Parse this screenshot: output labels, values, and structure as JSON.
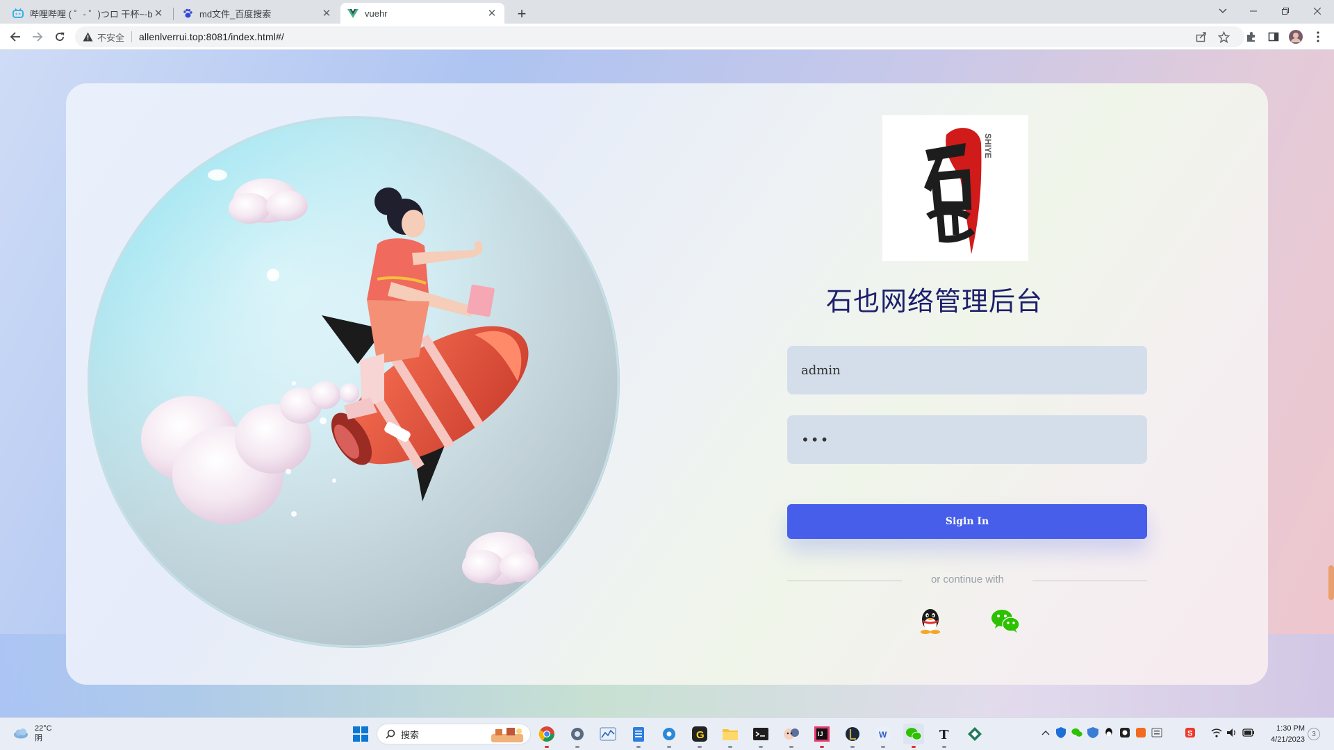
{
  "browser": {
    "tabs": [
      {
        "title": "哔哩哔哩 ( ゜- ゜)つロ 干杯~-bili",
        "icon": "bilibili-icon",
        "active": false
      },
      {
        "title": "md文件_百度搜索",
        "icon": "baidu-paw-icon",
        "active": false
      },
      {
        "title": "vuehr",
        "icon": "vue-icon",
        "active": true
      }
    ],
    "security_label": "不安全",
    "url": "allenlverrui.top:8081/index.html#/"
  },
  "login": {
    "logo_text": "SHIYE",
    "title": "石也网络管理后台",
    "username_value": "admin",
    "password_mask": "•••",
    "signin_label": "Sigin In",
    "divider_text": "or continue with",
    "social": [
      "qq-icon",
      "wechat-icon"
    ],
    "accent_color": "#465ee9",
    "title_color": "#1e1f6b"
  },
  "taskbar": {
    "weather_temp": "22°C",
    "weather_desc": "阴",
    "search_placeholder": "搜索",
    "time": "1:30 PM",
    "date": "4/21/2023",
    "notification_count": "3"
  }
}
